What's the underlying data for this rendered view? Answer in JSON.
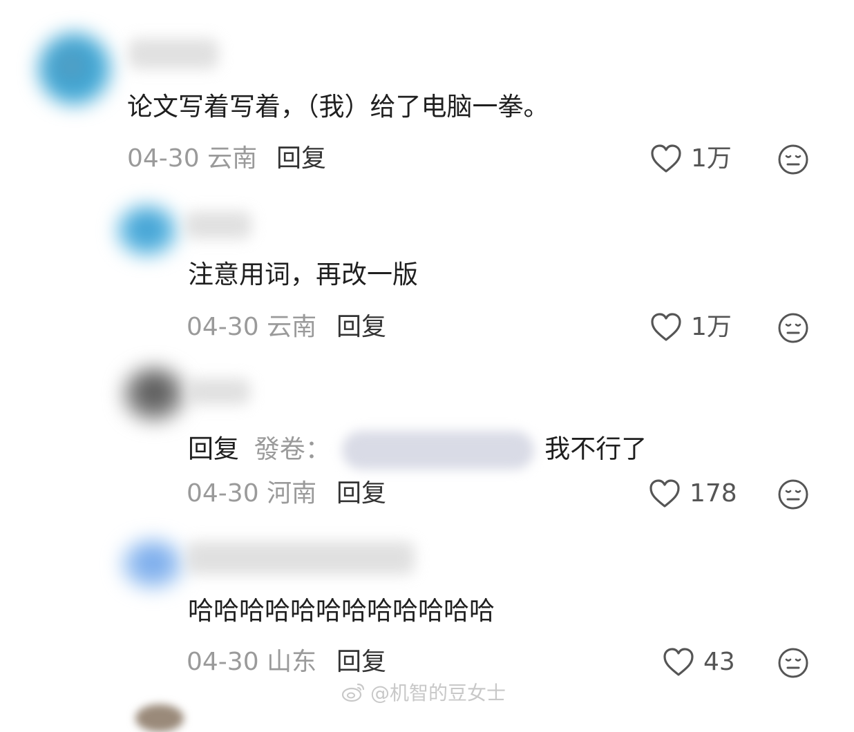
{
  "comments": [
    {
      "text": "论文写着写着，（我）给了电脑一拳。",
      "date": "04-30",
      "location": "云南",
      "reply_label": "回复",
      "likes": "1万"
    },
    {
      "text": "注意用词，再改一版",
      "date": "04-30",
      "location": "云南",
      "reply_label": "回复",
      "likes": "1万"
    },
    {
      "reply_prefix": "回复",
      "reply_target": "發卷：",
      "text": "我不行了",
      "date": "04-30",
      "location": "河南",
      "reply_label": "回复",
      "likes": "178"
    },
    {
      "text": "哈哈哈哈哈哈哈哈哈哈哈哈",
      "date": "04-30",
      "location": "山东",
      "reply_label": "回复",
      "likes": "43"
    }
  ],
  "watermark": {
    "text": "@机智的豆女士",
    "icon": "weibo-logo-icon"
  },
  "icons": {
    "like": "heart-outline-icon",
    "dislike": "meh-face-icon"
  },
  "colors": {
    "text": "#1f1f1f",
    "meta": "#9a9a9a",
    "icon": "#555555"
  }
}
